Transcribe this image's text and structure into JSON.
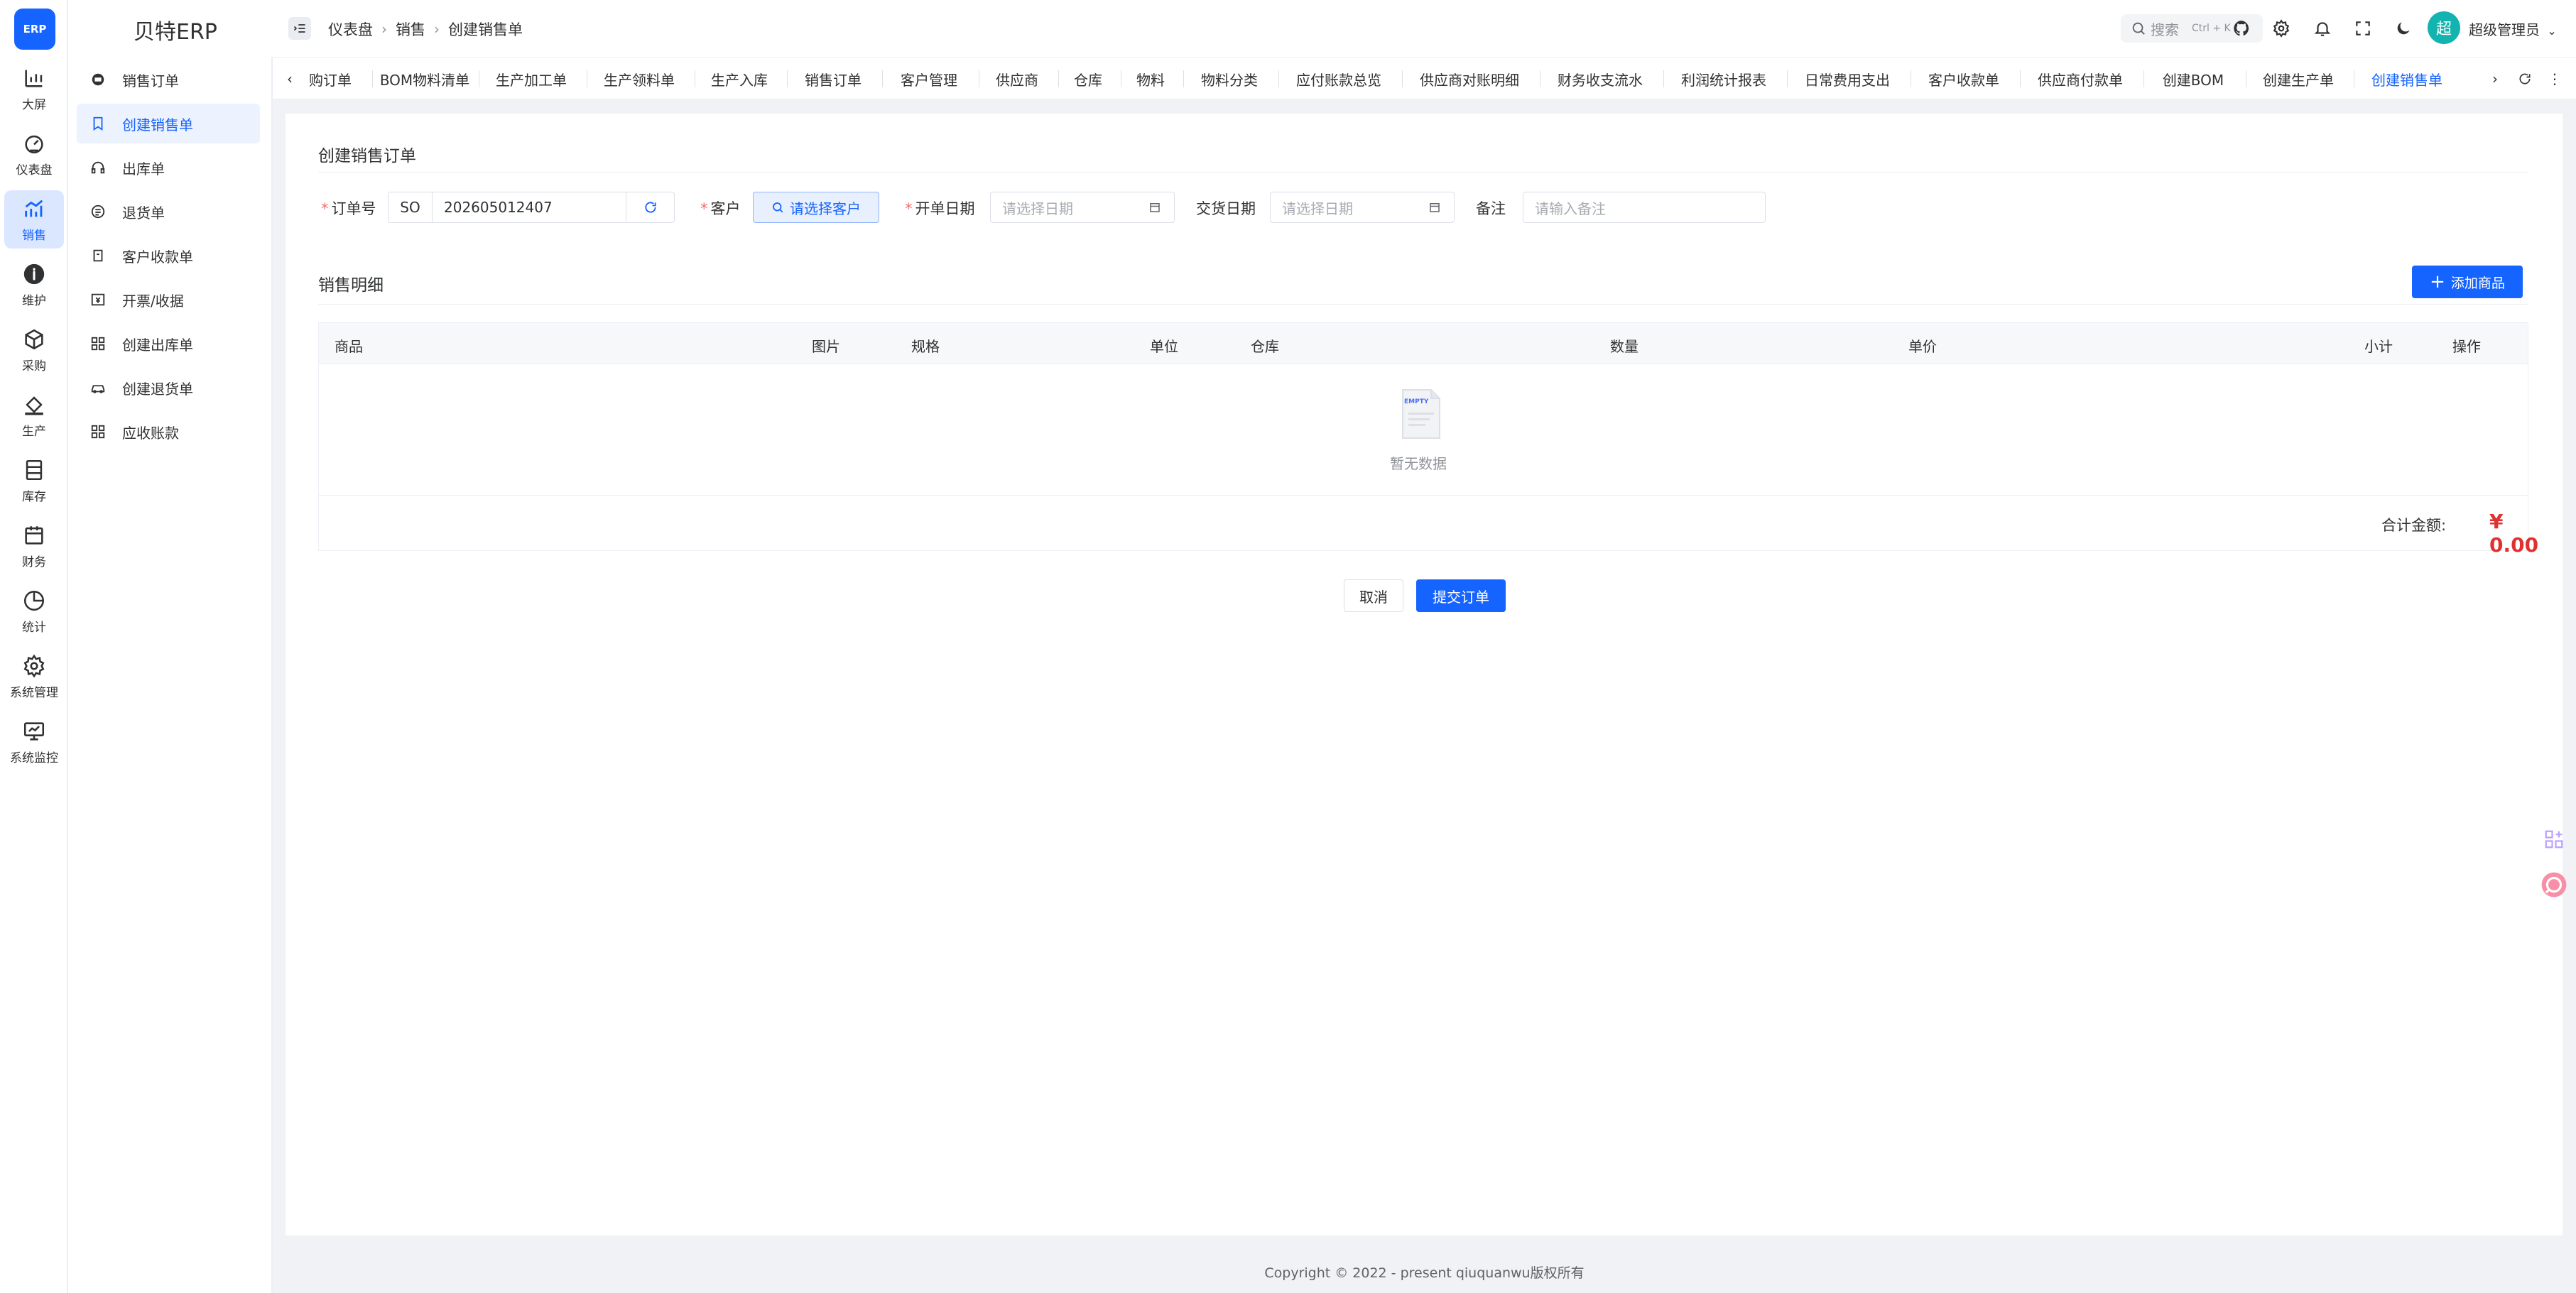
{
  "app": {
    "logo_text": "ERP",
    "name": "贝特ERP"
  },
  "rail": {
    "items": [
      {
        "label": "大屏",
        "icon": "bar-chart-icon"
      },
      {
        "label": "仪表盘",
        "icon": "dashboard-icon"
      },
      {
        "label": "销售",
        "icon": "sales-chart-icon",
        "active": true
      },
      {
        "label": "维护",
        "icon": "info-icon"
      },
      {
        "label": "采购",
        "icon": "box-icon"
      },
      {
        "label": "生产",
        "icon": "paint-bucket-icon"
      },
      {
        "label": "库存",
        "icon": "inventory-icon"
      },
      {
        "label": "财务",
        "icon": "calendar-icon"
      },
      {
        "label": "统计",
        "icon": "pie-chart-icon"
      },
      {
        "label": "系统管理",
        "icon": "gear-icon"
      },
      {
        "label": "系统监控",
        "icon": "monitor-icon"
      }
    ]
  },
  "submenu": {
    "items": [
      {
        "label": "销售订单",
        "icon": "order-icon"
      },
      {
        "label": "创建销售单",
        "icon": "bookmark-icon",
        "active": true
      },
      {
        "label": "出库单",
        "icon": "headset-icon"
      },
      {
        "label": "退货单",
        "icon": "return-icon"
      },
      {
        "label": "客户收款单",
        "icon": "receipt-icon"
      },
      {
        "label": "开票/收据",
        "icon": "invoice-icon"
      },
      {
        "label": "创建出库单",
        "icon": "grid-icon"
      },
      {
        "label": "创建退货单",
        "icon": "car-icon"
      },
      {
        "label": "应收账款",
        "icon": "grid-icon"
      }
    ]
  },
  "header": {
    "breadcrumb": [
      "仪表盘",
      "销售",
      "创建销售单"
    ],
    "search_placeholder": "搜索",
    "search_shortcut": "Ctrl + K",
    "avatar_text": "超",
    "user_name": "超级管理员"
  },
  "tabs": {
    "items": [
      "购订单",
      "BOM物料清单",
      "生产加工单",
      "生产领料单",
      "生产入库",
      "销售订单",
      "客户管理",
      "供应商",
      "仓库",
      "物料",
      "物料分类",
      "应付账款总览",
      "供应商对账明细",
      "财务收支流水",
      "利润统计报表",
      "日常费用支出",
      "客户收款单",
      "供应商付款单",
      "创建BOM",
      "创建生产单",
      "创建销售单"
    ],
    "active": "创建销售单"
  },
  "form": {
    "title": "创建销售订单",
    "order_no_label": "订单号",
    "order_prefix": "SO",
    "order_no": "202605012407",
    "customer_label": "客户",
    "customer_button": "请选择客户",
    "open_date_label": "开单日期",
    "open_date_placeholder": "请选择日期",
    "delivery_date_label": "交货日期",
    "delivery_date_placeholder": "请选择日期",
    "remark_label": "备注",
    "remark_placeholder": "请输入备注"
  },
  "details": {
    "title": "销售明细",
    "add_button": "添加商品",
    "columns": [
      "商品",
      "图片",
      "规格",
      "单位",
      "仓库",
      "数量",
      "单价",
      "小计",
      "操作"
    ],
    "rows": [],
    "empty_text": "暂无数据",
    "empty_icon_text": "EMPTY",
    "total_label": "合计金额:",
    "total_value": "¥ 0.00"
  },
  "actions": {
    "cancel": "取消",
    "submit": "提交订单"
  },
  "footer": {
    "copyright": "Copyright © 2022 - present qiuquanwu版权所有"
  },
  "colors": {
    "primary": "#1664ff",
    "danger": "#e03131",
    "avatar": "#13b3b0"
  }
}
